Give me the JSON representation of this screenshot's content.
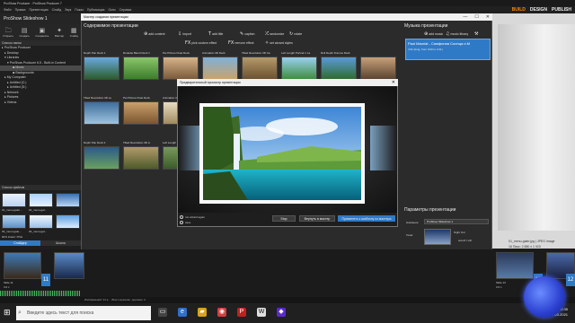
{
  "app": {
    "title": "ProShow Producer - ProShow Producer 7",
    "menu": [
      "Файл",
      "Правка",
      "Презентация",
      "Слайд",
      "Звук",
      "Показ",
      "Публикация",
      "Окно",
      "Справка"
    ],
    "project_title": "ProShow Slideshow 1",
    "modes": [
      "BUILD",
      "DESIGN",
      "PUBLISH"
    ]
  },
  "leftbar": {
    "buttons": [
      "Открыть",
      "Создать",
      "Сохранить",
      "Мастер",
      "Слайд"
    ]
  },
  "folders": {
    "header": "Список папок",
    "items": [
      "ProShow Producer",
      "Desktop",
      "Libraries",
      "ProShow Producer 6.5 - Built-in Content",
      "Music",
      "Backgrounds",
      "My Computer",
      "Untitled (C:)",
      "Untitled (D:)",
      "Network",
      "Pictures",
      "Videos"
    ],
    "selected_index": 4
  },
  "files": {
    "header": "Список файлов",
    "captions": [
      "01_menu-galer...",
      "02_menu-gal...",
      "03_menu-gale...",
      "04_menu-gal..."
    ],
    "info": "90% Класс: PNG",
    "tabs": [
      "Слайдер",
      "Шкала"
    ]
  },
  "dialog": {
    "title": "Мастер создания презентации",
    "window_controls": [
      "—",
      "☐",
      "✕"
    ]
  },
  "content": {
    "header": "Содержимое презентации",
    "tools_row1": [
      "add content",
      "import",
      "add title"
    ],
    "tools_row1_extra": [
      "caption",
      "randomize",
      "rotate"
    ],
    "tools_row2": [
      "pick custom effect",
      "remove effect",
      "set wizard styles"
    ],
    "slides": [
      {
        "caption": "Depth Pan Deck 1"
      },
      {
        "caption": "Roulette Blend Deck 1"
      },
      {
        "caption": "Pet Picture Float Deck"
      },
      {
        "caption": "Animation 3D Deck"
      },
      {
        "caption": "Tilted Revolution 3D Ca"
      },
      {
        "caption": "Left Length Portrait 1 La"
      },
      {
        "caption": "Roll Depth Frames Deck"
      },
      {
        "caption": "Tilted Revolution 3D Le"
      },
      {
        "caption": "Pet Picture Float Deck"
      },
      {
        "caption": "Animation 3D Deck 1"
      },
      {
        "caption": "Depth Pan Deck 2"
      },
      {
        "caption": "Tilted Revolution 3D Li"
      },
      {
        "caption": "Left Length Portrait 1 Le"
      },
      {
        "caption": "Pet Picture Float Deck 2"
      }
    ]
  },
  "music": {
    "header": "Музыка презентации",
    "tools": [
      "add music",
      "music library"
    ],
    "track": {
      "title": "Paul Mauriat - Симфония Солнца и М",
      "info": "4:31 (long, from 0:00 to 4:31)"
    }
  },
  "params": {
    "header": "Параметры презентации",
    "name_label": "Название:",
    "name_value": "ProShow Slideshow 1",
    "theme_label": "Тема:",
    "theme_value": "Night Out",
    "auto_label": "auto/if I will",
    "aspect_label": "Стороны:",
    "aspect_values": [
      "wide (16:9)",
      "std (4:3)"
    ],
    "level_label": "Уровень:",
    "level_values": [
      "auto",
      "custom"
    ],
    "length_label": "Длительность:",
    "length_value": "2 минуты",
    "help_icon": "?"
  },
  "footer": {
    "help": "Help",
    "cancel": "Отмена",
    "proceed": "Продолжить в Producer"
  },
  "preview": {
    "title": "Предварительный просмотр презентации",
    "run_again": "run wizard again",
    "save": "save",
    "stop": "Stop",
    "back": "Вернуть в мастер",
    "apply": "Применить к шаблону из мастера"
  },
  "work": {
    "caption": "01_menu-galer.jpg  | JPEG image",
    "resolution": "16 Пикс: 2 880 x 1 920"
  },
  "timeline": {
    "slides": [
      {
        "num": "11",
        "label": "Slide 11",
        "time": "3.0 с"
      },
      {
        "num": "12",
        "label": "Slide 12",
        "time": "3.0 с"
      },
      {
        "num": "13",
        "label": "Slide 13",
        "time": "3.0 с"
      }
    ]
  },
  "status": {
    "text": "Изображений: 31 в ... Всего музыкал. дорожек: 4"
  },
  "taskbar": {
    "search_placeholder": "Введите здесь текст для поиска",
    "time": "20:35",
    "date": "29.03.2021"
  }
}
